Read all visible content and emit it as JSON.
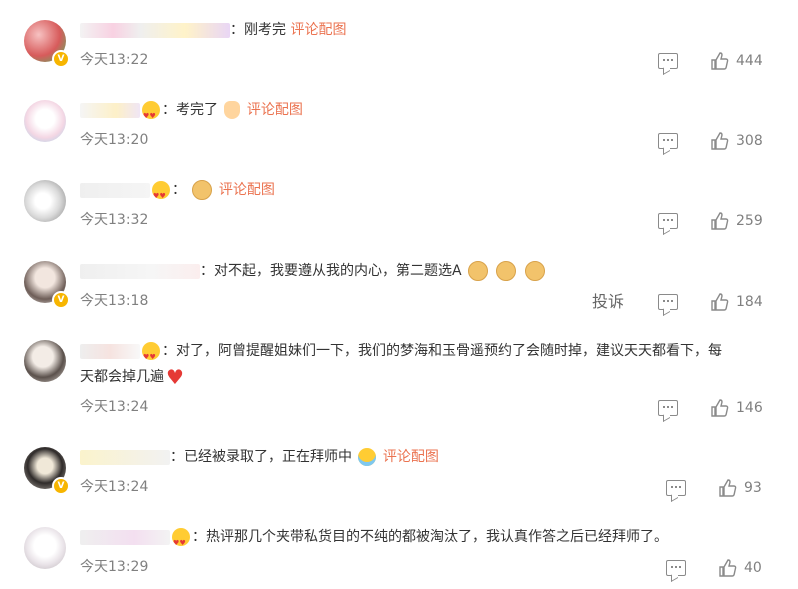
{
  "comments": [
    {
      "text": "：刚考完",
      "link": "评论配图",
      "time": "今天13:22",
      "likes": "444",
      "avatar_color": "#e98a8a",
      "verified": true
    },
    {
      "text": "：考完了",
      "link": "评论配图",
      "time": "今天13:20",
      "likes": "308",
      "avatar_color": "#f3e7ef",
      "verified": false
    },
    {
      "text": "：",
      "link": "评论配图",
      "time": "今天13:32",
      "likes": "259",
      "avatar_color": "#d7d7d7",
      "verified": false
    },
    {
      "text": "：对不起，我要遵从我的内心，第二题选A",
      "link": "",
      "time": "今天13:18",
      "likes": "184",
      "avatar_color": "#cfcac6",
      "verified": true,
      "report": "投诉"
    },
    {
      "text1": "：对了，阿曾提醒姐妹们一下，我们的梦海和玉骨遥预约了会随时掉，建议天天都看下，每",
      "text2": "天都会掉几遍",
      "time": "今天13:24",
      "likes": "146",
      "avatar_color": "#bdb3ab",
      "verified": false
    },
    {
      "text": "：已经被录取了，正在拜师中",
      "link": "评论配图",
      "time": "今天13:24",
      "likes": "93",
      "avatar_color": "#8f8a86",
      "verified": true
    },
    {
      "text": "：热评那几个夹带私货目的不纯的都被淘汰了，我认真作答之后已经拜师了。",
      "link": "",
      "time": "今天13:29",
      "likes": "40",
      "avatar_color": "#ece9ec",
      "verified": false
    }
  ],
  "icons": {
    "reply": "reply-icon",
    "like": "thumbs-up-icon",
    "verified": "verified-badge-icon"
  },
  "colors": {
    "link": "#eb7350",
    "meta": "#808080",
    "text": "#333333"
  }
}
